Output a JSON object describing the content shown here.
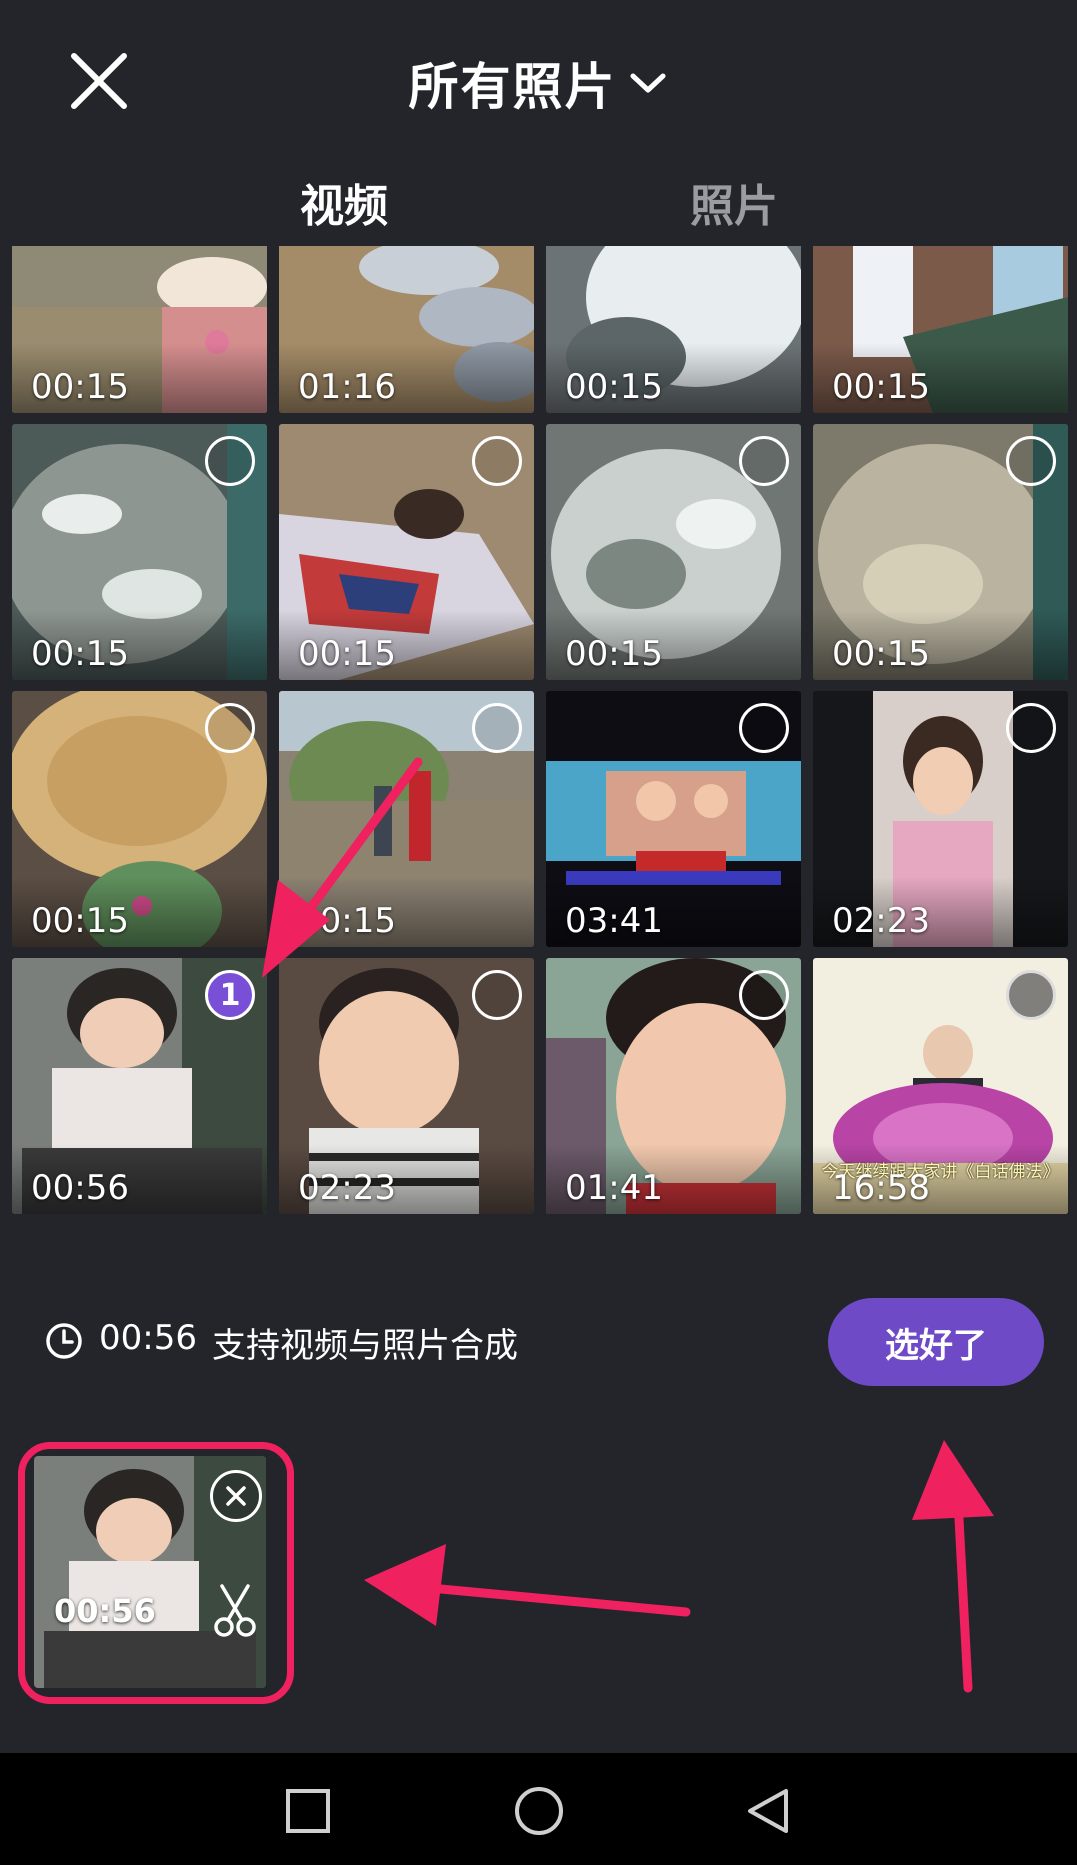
{
  "header": {
    "title": "所有照片",
    "close_icon": "close-icon",
    "dropdown_icon": "chevron-down-icon"
  },
  "tabs": [
    {
      "label": "视频",
      "active": true
    },
    {
      "label": "照片",
      "active": false
    }
  ],
  "grid": {
    "items": [
      {
        "duration": "00:15",
        "state": "unselected"
      },
      {
        "duration": "01:16",
        "state": "unselected"
      },
      {
        "duration": "00:15",
        "state": "unselected"
      },
      {
        "duration": "00:15",
        "state": "unselected"
      },
      {
        "duration": "00:15",
        "state": "unselected"
      },
      {
        "duration": "00:15",
        "state": "unselected"
      },
      {
        "duration": "00:15",
        "state": "unselected"
      },
      {
        "duration": "00:15",
        "state": "unselected"
      },
      {
        "duration": "00:15",
        "state": "unselected"
      },
      {
        "duration": "00:15",
        "state": "unselected"
      },
      {
        "duration": "03:41",
        "state": "unselected"
      },
      {
        "duration": "02:23",
        "state": "unselected"
      },
      {
        "duration": "00:56",
        "state": "selected",
        "order": "1"
      },
      {
        "duration": "02:23",
        "state": "unselected"
      },
      {
        "duration": "01:41",
        "state": "unselected"
      },
      {
        "duration": "16:58",
        "state": "disabled",
        "caption": "今天继续跟大家讲《白话佛法》"
      }
    ]
  },
  "info_bar": {
    "icon": "clock-icon",
    "total_duration": "00:56",
    "hint": "支持视频与照片合成",
    "done_label": "选好了"
  },
  "tray": {
    "selected": [
      {
        "duration": "00:56",
        "remove_icon": "close-circle-icon",
        "trim_icon": "scissors-icon"
      }
    ],
    "highlight_color": "#f0215f"
  },
  "colors": {
    "background": "#23252b",
    "accent": "#6f4ac7",
    "annotation": "#f0215f"
  },
  "nav": {
    "icons": [
      "square-recent-icon",
      "circle-home-icon",
      "triangle-back-icon"
    ]
  }
}
